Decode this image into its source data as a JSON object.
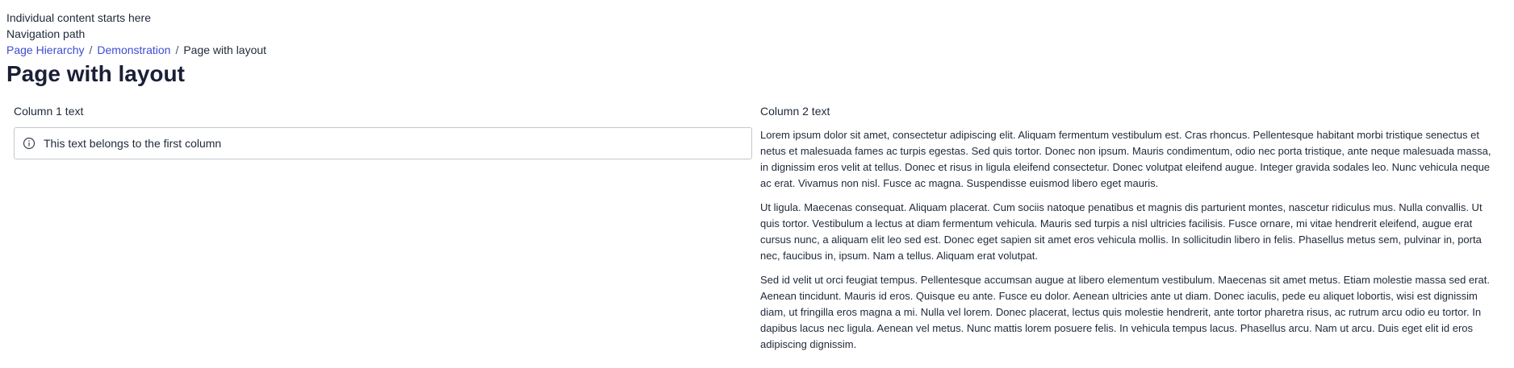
{
  "header": {
    "intro": "Individual content starts here",
    "nav_label": "Navigation path"
  },
  "breadcrumb": {
    "items": [
      "Page Hierarchy",
      "Demonstration"
    ],
    "separator": "/",
    "current": "Page with layout"
  },
  "page": {
    "title": "Page with layout"
  },
  "column1": {
    "label": "Column 1 text",
    "info_text": "This text belongs to the first column",
    "icon": "info-icon"
  },
  "column2": {
    "label": "Column 2 text",
    "paragraphs": [
      "Lorem ipsum dolor sit amet, consectetur adipiscing elit. Aliquam fermentum vestibulum est. Cras rhoncus. Pellentesque habitant morbi tristique senectus et netus et malesuada fames ac turpis egestas. Sed quis tortor. Donec non ipsum. Mauris condimentum, odio nec porta tristique, ante neque malesuada massa, in dignissim eros velit at tellus. Donec et risus in ligula eleifend consectetur. Donec volutpat eleifend augue. Integer gravida sodales leo. Nunc vehicula neque ac erat. Vivamus non nisl. Fusce ac magna. Suspendisse euismod libero eget mauris.",
      "Ut ligula. Maecenas consequat. Aliquam placerat. Cum sociis natoque penatibus et magnis dis parturient montes, nascetur ridiculus mus. Nulla convallis. Ut quis tortor. Vestibulum a lectus at diam fermentum vehicula. Mauris sed turpis a nisl ultricies facilisis. Fusce ornare, mi vitae hendrerit eleifend, augue erat cursus nunc, a aliquam elit leo sed est. Donec eget sapien sit amet eros vehicula mollis. In sollicitudin libero in felis. Phasellus metus sem, pulvinar in, porta nec, faucibus in, ipsum. Nam a tellus. Aliquam erat volutpat.",
      "Sed id velit ut orci feugiat tempus. Pellentesque accumsan augue at libero elementum vestibulum. Maecenas sit amet metus. Etiam molestie massa sed erat. Aenean tincidunt. Mauris id eros. Quisque eu ante. Fusce eu dolor. Aenean ultricies ante ut diam. Donec iaculis, pede eu aliquet lobortis, wisi est dignissim diam, ut fringilla eros magna a mi. Nulla vel lorem. Donec placerat, lectus quis molestie hendrerit, ante tortor pharetra risus, ac rutrum arcu odio eu tortor. In dapibus lacus nec ligula. Aenean vel metus. Nunc mattis lorem posuere felis. In vehicula tempus lacus. Phasellus arcu. Nam ut arcu. Duis eget elit id eros adipiscing dignissim."
    ]
  },
  "colors": {
    "link": "#3d4cd4",
    "text": "#1f2937",
    "title": "#1a1f36",
    "border": "#c4c7cc"
  }
}
